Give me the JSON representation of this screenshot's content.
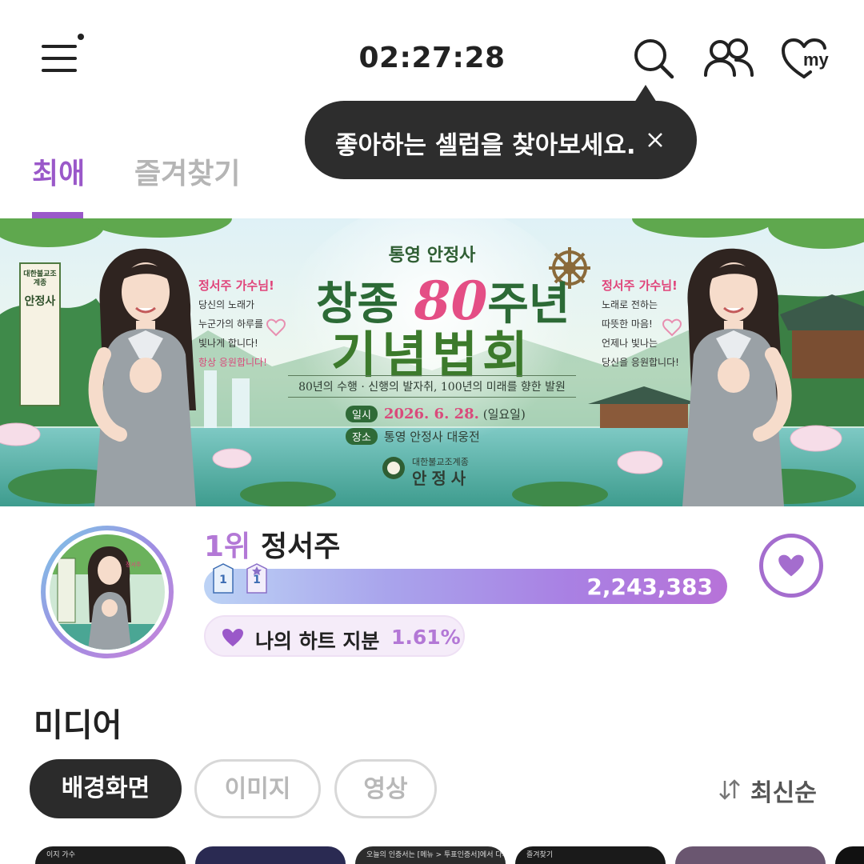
{
  "header": {
    "clock": "02:27:28",
    "icons": [
      "menu-icon",
      "search-icon",
      "people-icon",
      "heart-my-icon"
    ],
    "my_label": "my"
  },
  "tooltip": {
    "text": "좋아하는 셀럽을 찾아보세요."
  },
  "tabs": [
    {
      "label": "최애",
      "active": true
    },
    {
      "label": "즐겨찾기",
      "active": false
    }
  ],
  "banner": {
    "temple": "통영 안정사",
    "title_prefix": "창종",
    "title_number": "80",
    "title_suffix": "주년",
    "title_line2": "기념법회",
    "subtitle": "80년의 수행 · 신행의 발자취, 100년의 미래를 향한 발원",
    "date_label": "일시",
    "date_value": "2026. 6. 28.",
    "date_day": "(일요일)",
    "place_label": "장소",
    "place_value": "통영 안정사 대웅전",
    "org_small": "대한불교조계종",
    "org": "안정사",
    "vertical_small": "대한불교조계종",
    "vertical_main": "안정사",
    "left_msg": {
      "head": "정서주 가수님!",
      "lines": [
        "당신의 노래가",
        "누군가의 하루를",
        "빛나게 합니다!"
      ],
      "foot": "항상 응원합니다!"
    },
    "right_msg": {
      "head": "정서주 가수님!",
      "lines": [
        "노래로 전하는",
        "따뜻한 마음!",
        "언제나 빛나는",
        "당신을 응원합니다!"
      ]
    }
  },
  "ranking": {
    "rank": "1위",
    "name": "정서주",
    "votes": "2,243,383",
    "badges": [
      "1",
      "1"
    ],
    "share_label": "나의 하트 지분",
    "share_value": "1.61%"
  },
  "media": {
    "title": "미디어",
    "chips": [
      {
        "label": "배경화면",
        "active": true
      },
      {
        "label": "이미지",
        "active": false
      },
      {
        "label": "영상",
        "active": false
      }
    ],
    "sort_label": "최신순",
    "thumb_texts": [
      "이지 가수",
      "",
      "오늘의 인증서는 [메뉴 > 투표인증서]에서 다시 볼 수 있어요",
      "즐겨찾기",
      "",
      ""
    ]
  },
  "colors": {
    "accent": "#9a58c9",
    "tooltip_bg": "#2d2d2d",
    "dark_chip": "#2b2b2b"
  }
}
